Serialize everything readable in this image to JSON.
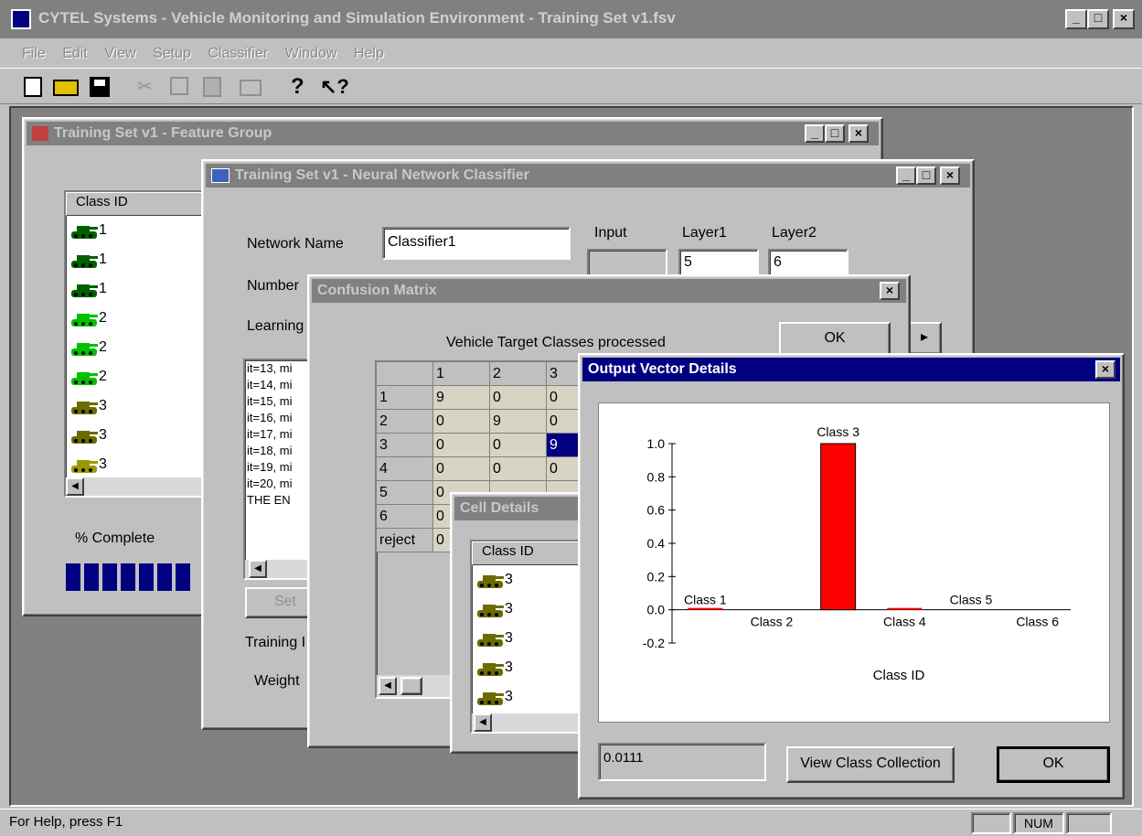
{
  "app": {
    "title": "CYTEL Systems - Vehicle Monitoring and Simulation Environment - Training Set v1.fsv",
    "menu": [
      "File",
      "Edit",
      "View",
      "Setup",
      "Classifier",
      "Window",
      "Help"
    ],
    "status_text": "For Help, press F1",
    "status_num": "NUM"
  },
  "feature_group": {
    "title": "Training Set v1 - Feature Group",
    "column_header": "Class ID",
    "items": [
      {
        "label": "1",
        "color": "#006000"
      },
      {
        "label": "1",
        "color": "#006000"
      },
      {
        "label": "1",
        "color": "#006000"
      },
      {
        "label": "2",
        "color": "#00c000"
      },
      {
        "label": "2",
        "color": "#00c000"
      },
      {
        "label": "2",
        "color": "#00c000"
      },
      {
        "label": "3",
        "color": "#6b6b00"
      },
      {
        "label": "3",
        "color": "#6b6b00"
      },
      {
        "label": "3",
        "color": "#9a9a00"
      }
    ],
    "complete_label": "% Complete",
    "progress_blocks": 7
  },
  "nn_classifier": {
    "title": "Training Set v1 - Neural Network Classifier",
    "network_name_label": "Network Name",
    "network_name_value": "Classifier1",
    "input_label": "Input",
    "layer1_label": "Layer1",
    "layer1_value": "5",
    "layer2_label": "Layer2",
    "layer2_value": "6",
    "number_label": "Number",
    "learning_label": "Learning",
    "log_lines": [
      "it=13, mi",
      "it=14, mi",
      "it=15, mi",
      "it=16, mi",
      "it=17, mi",
      "it=18, mi",
      "it=19, mi",
      "it=20, mi",
      "THE EN"
    ],
    "set_button": "Set",
    "training_label": "Training I",
    "weight_label": "Weight"
  },
  "confusion": {
    "title": "Confusion Matrix",
    "subtitle": "Vehicle Target Classes processed",
    "ok": "OK",
    "col_headers": [
      "1",
      "2",
      "3"
    ],
    "rows": [
      {
        "label": "1",
        "cells": [
          "9",
          "0",
          "0"
        ]
      },
      {
        "label": "2",
        "cells": [
          "0",
          "9",
          "0"
        ]
      },
      {
        "label": "3",
        "cells": [
          "0",
          "0",
          "9"
        ]
      },
      {
        "label": "4",
        "cells": [
          "0",
          "0",
          "0"
        ]
      },
      {
        "label": "5",
        "cells": [
          "0",
          "",
          ""
        ]
      },
      {
        "label": "6",
        "cells": [
          "0",
          "",
          ""
        ]
      },
      {
        "label": "reject",
        "cells": [
          "0",
          "",
          ""
        ]
      }
    ]
  },
  "cell_details": {
    "title": "Cell Details",
    "column_header": "Class ID",
    "items": [
      "3",
      "3",
      "3",
      "3",
      "3"
    ]
  },
  "output_vector": {
    "title": "Output Vector Details",
    "value_box": "0.0111",
    "view_button": "View Class Collection",
    "ok_button": "OK"
  },
  "chart_data": {
    "type": "bar",
    "categories": [
      "Class 1",
      "Class 2",
      "Class 3",
      "Class 4",
      "Class 5",
      "Class 6"
    ],
    "values": [
      0.0111,
      0.0,
      1.0,
      0.005,
      0.0,
      0.0
    ],
    "bar_color": "#ff0000",
    "xlabel": "Class ID",
    "ylabel": "",
    "ylim": [
      -0.2,
      1.0
    ],
    "yticks": [
      "1.0",
      "0.8",
      "0.6",
      "0.4",
      "0.2",
      "0.0",
      "-0.2"
    ],
    "grid": false
  }
}
